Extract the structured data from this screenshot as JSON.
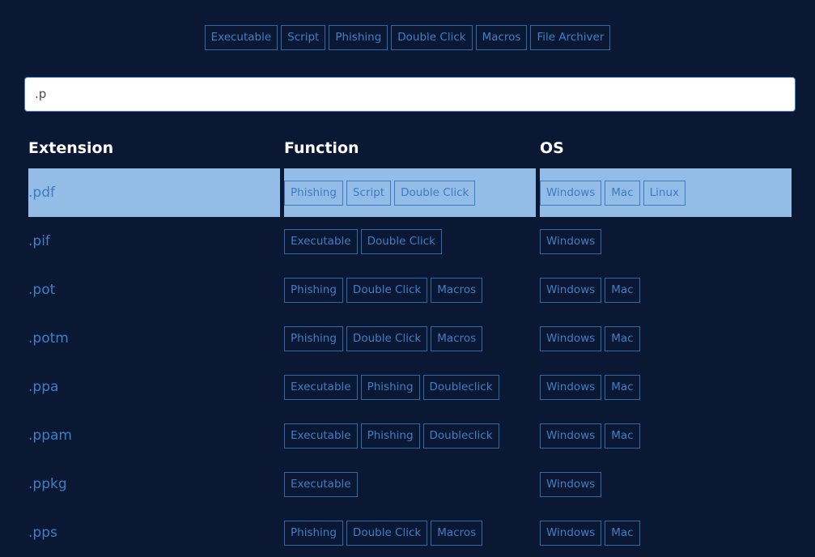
{
  "filters": [
    "Executable",
    "Script",
    "Phishing",
    "Double Click",
    "Macros",
    "File Archiver"
  ],
  "search": {
    "value": ".p"
  },
  "columns": {
    "extension": "Extension",
    "function": "Function",
    "os": "OS"
  },
  "rows": [
    {
      "ext": ".pdf",
      "functions": [
        "Phishing",
        "Script",
        "Double Click"
      ],
      "os": [
        "Windows",
        "Mac",
        "Linux"
      ],
      "selected": true
    },
    {
      "ext": ".pif",
      "functions": [
        "Executable",
        "Double Click"
      ],
      "os": [
        "Windows"
      ]
    },
    {
      "ext": ".pot",
      "functions": [
        "Phishing",
        "Double Click",
        "Macros"
      ],
      "os": [
        "Windows",
        "Mac"
      ]
    },
    {
      "ext": ".potm",
      "functions": [
        "Phishing",
        "Double Click",
        "Macros"
      ],
      "os": [
        "Windows",
        "Mac"
      ]
    },
    {
      "ext": ".ppa",
      "functions": [
        "Executable",
        "Phishing",
        "Doubleclick"
      ],
      "os": [
        "Windows",
        "Mac"
      ]
    },
    {
      "ext": ".ppam",
      "functions": [
        "Executable",
        "Phishing",
        "Doubleclick"
      ],
      "os": [
        "Windows",
        "Mac"
      ]
    },
    {
      "ext": ".ppkg",
      "functions": [
        "Executable"
      ],
      "os": [
        "Windows"
      ]
    },
    {
      "ext": ".pps",
      "functions": [
        "Phishing",
        "Double Click",
        "Macros"
      ],
      "os": [
        "Windows",
        "Mac"
      ]
    }
  ]
}
